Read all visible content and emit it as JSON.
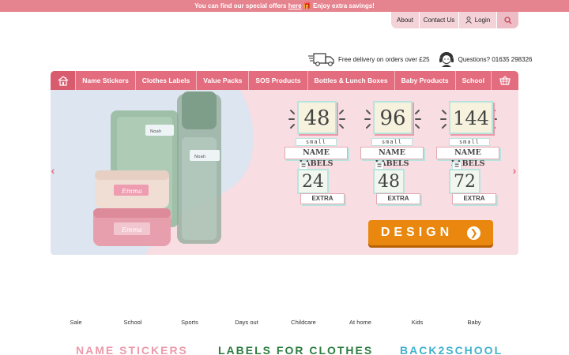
{
  "promo": {
    "before": "You can find our special offers ",
    "link": "here",
    "after": " 🎁 Enjoy extra savings!"
  },
  "top_links": {
    "about": "About",
    "contact": "Contact Us",
    "login": "Login"
  },
  "info": {
    "delivery": "Free delivery on orders over £25",
    "questions": "Questions? 01635 298326"
  },
  "nav": {
    "items": [
      "Name Stickers",
      "Clothes Labels",
      "Value Packs",
      "SOS Products",
      "Bottles & Lunch Boxes",
      "Baby Products",
      "School"
    ]
  },
  "hero": {
    "product_names": {
      "box": "Noah",
      "bottle": "Noah",
      "lunchbox_top": "Emma",
      "lunchbox_bottom": "Emma"
    },
    "offers": [
      {
        "count": "48",
        "size": "small",
        "label": "NAME LABELS",
        "eq": "=",
        "extra": "24",
        "extra_label": "EXTRA"
      },
      {
        "count": "96",
        "size": "small",
        "label": "NAME LABELS",
        "eq": "=",
        "extra": "48",
        "extra_label": "EXTRA"
      },
      {
        "count": "144",
        "size": "small",
        "label": "NAME LABELS",
        "eq": "=",
        "extra": "72",
        "extra_label": "EXTRA"
      }
    ],
    "design_button": "DESIGN",
    "colors": {
      "accent": "#e36d7e",
      "button": "#e9870e",
      "bg_blue": "#dde5f0",
      "bg_pink": "#f8dde2"
    }
  },
  "categories": [
    "Sale",
    "School",
    "Sports",
    "Days out",
    "Childcare",
    "At home",
    "Kids",
    "Baby"
  ],
  "sections": {
    "name_stickers": "NAME STICKERS",
    "clothes": "LABELS FOR CLOTHES",
    "back2school": "BACK2SCHOOL"
  },
  "icons": [
    "truck-icon",
    "support-icon",
    "user-icon",
    "search-icon",
    "home-icon",
    "basket-icon",
    "chevron-left-icon",
    "chevron-right-icon",
    "arrow-right-icon"
  ]
}
